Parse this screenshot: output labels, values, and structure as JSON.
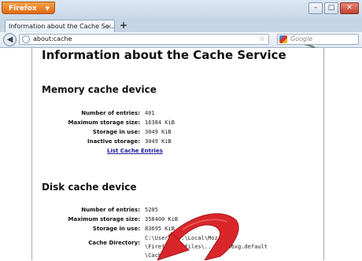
{
  "titlebar": {
    "app_menu_label": "Firefox",
    "minimize_glyph": "–",
    "maximize_glyph": "□",
    "close_glyph": "✕"
  },
  "tabs": [
    {
      "label": "Information about the Cache Se...",
      "close_glyph": "×"
    }
  ],
  "newtab_glyph": "+",
  "navbar": {
    "back_glyph": "◀",
    "url": "about:cache",
    "bookmark_glyph": "☆",
    "search_placeholder": "Google"
  },
  "page": {
    "title": "Information about the Cache Service",
    "memory": {
      "heading": "Memory cache device",
      "rows": [
        {
          "label": "Number of entries:",
          "value": "401"
        },
        {
          "label": "Maximum storage size:",
          "value": "16384 KiB"
        },
        {
          "label": "Storage in use:",
          "value": "3049 KiB"
        },
        {
          "label": "Inactive storage:",
          "value": "3049 KiB"
        }
      ],
      "link": "List Cache Entries"
    },
    "disk": {
      "heading": "Disk cache device",
      "rows": [
        {
          "label": "Number of entries:",
          "value": "5205"
        },
        {
          "label": "Maximum storage size:",
          "value": "358400 KiB"
        },
        {
          "label": "Storage in use:",
          "value": "83695 KiB"
        },
        {
          "label": "Cache Directory:",
          "value": "C:\\Users\\...\\Local\\Mozilla"
        }
      ],
      "dir_line2": "\\Firefox\\Profiles\\...9y44w6xg.default",
      "dir_line3": "\\Cache"
    }
  },
  "colors": {
    "annotation_arrow": "#d8262a",
    "link": "#1a1a9c",
    "firefox_button": "#e87a20"
  }
}
